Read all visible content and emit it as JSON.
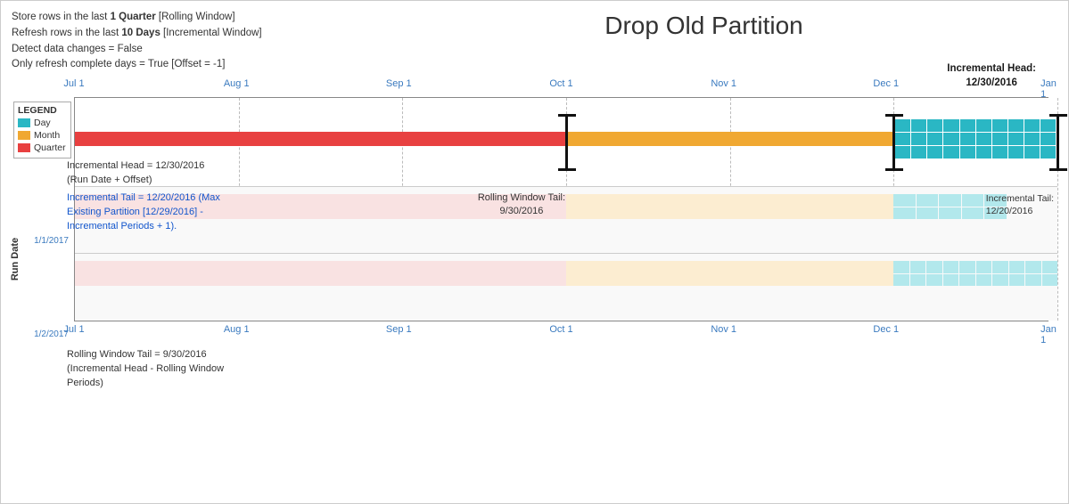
{
  "title": "Drop Old Partition",
  "info": {
    "line1_prefix": "Store rows in the last ",
    "line1_bold": "1 Quarter",
    "line1_suffix": " [Rolling Window]",
    "line2_prefix": "Refresh rows in the last ",
    "line2_bold": "10 Days",
    "line2_suffix": " [Incremental Window]",
    "line3": "Detect data changes = False",
    "line4": "Only refresh complete days = True [Offset = -1]"
  },
  "inc_head_top": {
    "line1": "Incremental Head:",
    "line2": "12/30/2016"
  },
  "legend": {
    "title": "LEGEND",
    "items": [
      {
        "label": "Day",
        "color": "#2ab7c4"
      },
      {
        "label": "Month",
        "color": "#f0a832"
      },
      {
        "label": "Quarter",
        "color": "#e84040"
      }
    ]
  },
  "axis": {
    "labels": [
      "Jul 1",
      "Aug 1",
      "Sep 1",
      "Oct 1",
      "Nov 1",
      "Dec 1",
      "Jan 1"
    ],
    "positions_pct": [
      0,
      16.67,
      33.33,
      50.0,
      66.67,
      83.33,
      100.0
    ]
  },
  "annotations": {
    "run1": {
      "inc_head": "Incremental Head = 12/30/2016\n(Run Date + Offset)",
      "inc_tail": "Incremental Tail = 12/20/2016 (Max\nExisting Partition [12/29/2016] -\nIncremental Periods + 1).",
      "rolling_tail_label": "Rolling Window Tail:\n9/30/2016",
      "inc_tail_label": "Incremental Tail:\n12/20/2016"
    },
    "run2": {
      "rolling_tail_label": "Rolling Window Tail = 9/30/2016\n(Incremental Head - Rolling Window\nPeriods)"
    }
  },
  "run_dates": {
    "label": "Run Date",
    "date1": "1/1/2017",
    "date2": "1/2/2017"
  },
  "colors": {
    "day": "#2ab7c4",
    "month": "#f0a832",
    "quarter": "#e84040",
    "day_light": "#b2e8ec",
    "quarter_light": "#f9c2c2",
    "month_light": "#fde8b8"
  }
}
